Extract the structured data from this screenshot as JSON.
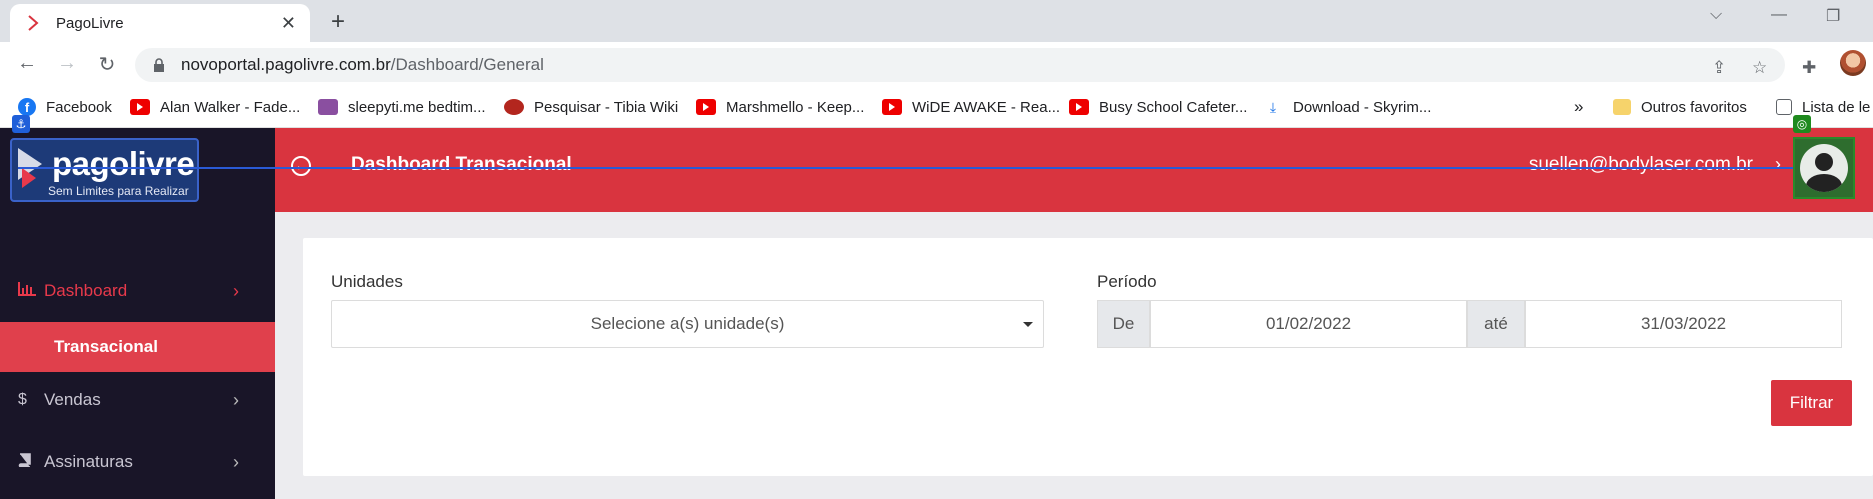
{
  "browser": {
    "tab_title": "PagoLivre",
    "url_host": "novoportal.pagolivre.com.br",
    "url_path": "/Dashboard/General",
    "bookmarks": [
      {
        "label": "Facebook",
        "icon": "facebook-icon"
      },
      {
        "label": "Alan Walker - Fade...",
        "icon": "youtube-icon"
      },
      {
        "label": "sleepyti.me bedtim...",
        "icon": "sleepytime-icon"
      },
      {
        "label": "Pesquisar - Tibia Wiki",
        "icon": "tibia-icon"
      },
      {
        "label": "Marshmello - Keep...",
        "icon": "youtube-icon"
      },
      {
        "label": "WiDE AWAKE - Rea...",
        "icon": "youtube-icon"
      },
      {
        "label": "Busy School Cafeter...",
        "icon": "youtube-icon"
      },
      {
        "label": "Download - Skyrim...",
        "icon": "download-icon"
      }
    ],
    "overflow": "»",
    "other_bookmarks": "Outros favoritos",
    "reading_list": "Lista de le"
  },
  "sidebar": {
    "logo_word": "pagolivre",
    "logo_tagline": "Sem Limites para Realizar",
    "items": [
      {
        "label": "Dashboard",
        "icon": "chart-icon",
        "active": true
      },
      {
        "label": "Vendas",
        "icon": "dollar-icon",
        "active": false
      },
      {
        "label": "Assinaturas",
        "icon": "book-icon",
        "active": false
      }
    ],
    "submenu_label": "Transacional"
  },
  "header": {
    "title": "Dashboard Transacional",
    "email": "suellen@bodylaser.com.br"
  },
  "filters": {
    "unidades_label": "Unidades",
    "unidades_placeholder": "Selecione a(s) unidade(s)",
    "periodo_label": "Período",
    "from_label": "De",
    "from_value": "01/02/2022",
    "to_label": "até",
    "to_value": "31/03/2022",
    "filter_button": "Filtrar"
  },
  "colors": {
    "accent": "#d9343f",
    "sidebar_bg": "#191528",
    "content_bg": "#ececef"
  }
}
